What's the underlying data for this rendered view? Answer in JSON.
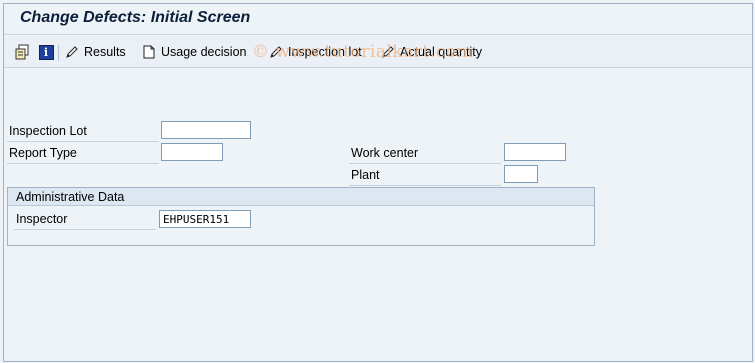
{
  "title": "Change Defects: Initial Screen",
  "toolbar": {
    "icons": [
      "copy-icon",
      "info-icon"
    ],
    "buttons": [
      {
        "label": "Results",
        "icon": "pencil-icon"
      },
      {
        "label": "Usage decision",
        "icon": "document-icon"
      },
      {
        "label": "Inspection lot",
        "icon": "pencil-icon"
      },
      {
        "label": "Actual quantity",
        "icon": "pencil-icon"
      }
    ]
  },
  "watermark": "© www.tutorialkart.com",
  "fields": {
    "inspection_lot": {
      "label": "Inspection Lot",
      "value": ""
    },
    "report_type": {
      "label": "Report Type",
      "value": ""
    },
    "work_center": {
      "label": "Work center",
      "value": ""
    },
    "plant": {
      "label": "Plant",
      "value": ""
    }
  },
  "admin": {
    "header": "Administrative Data",
    "inspector": {
      "label": "Inspector",
      "value": "EHPUSER151"
    }
  }
}
